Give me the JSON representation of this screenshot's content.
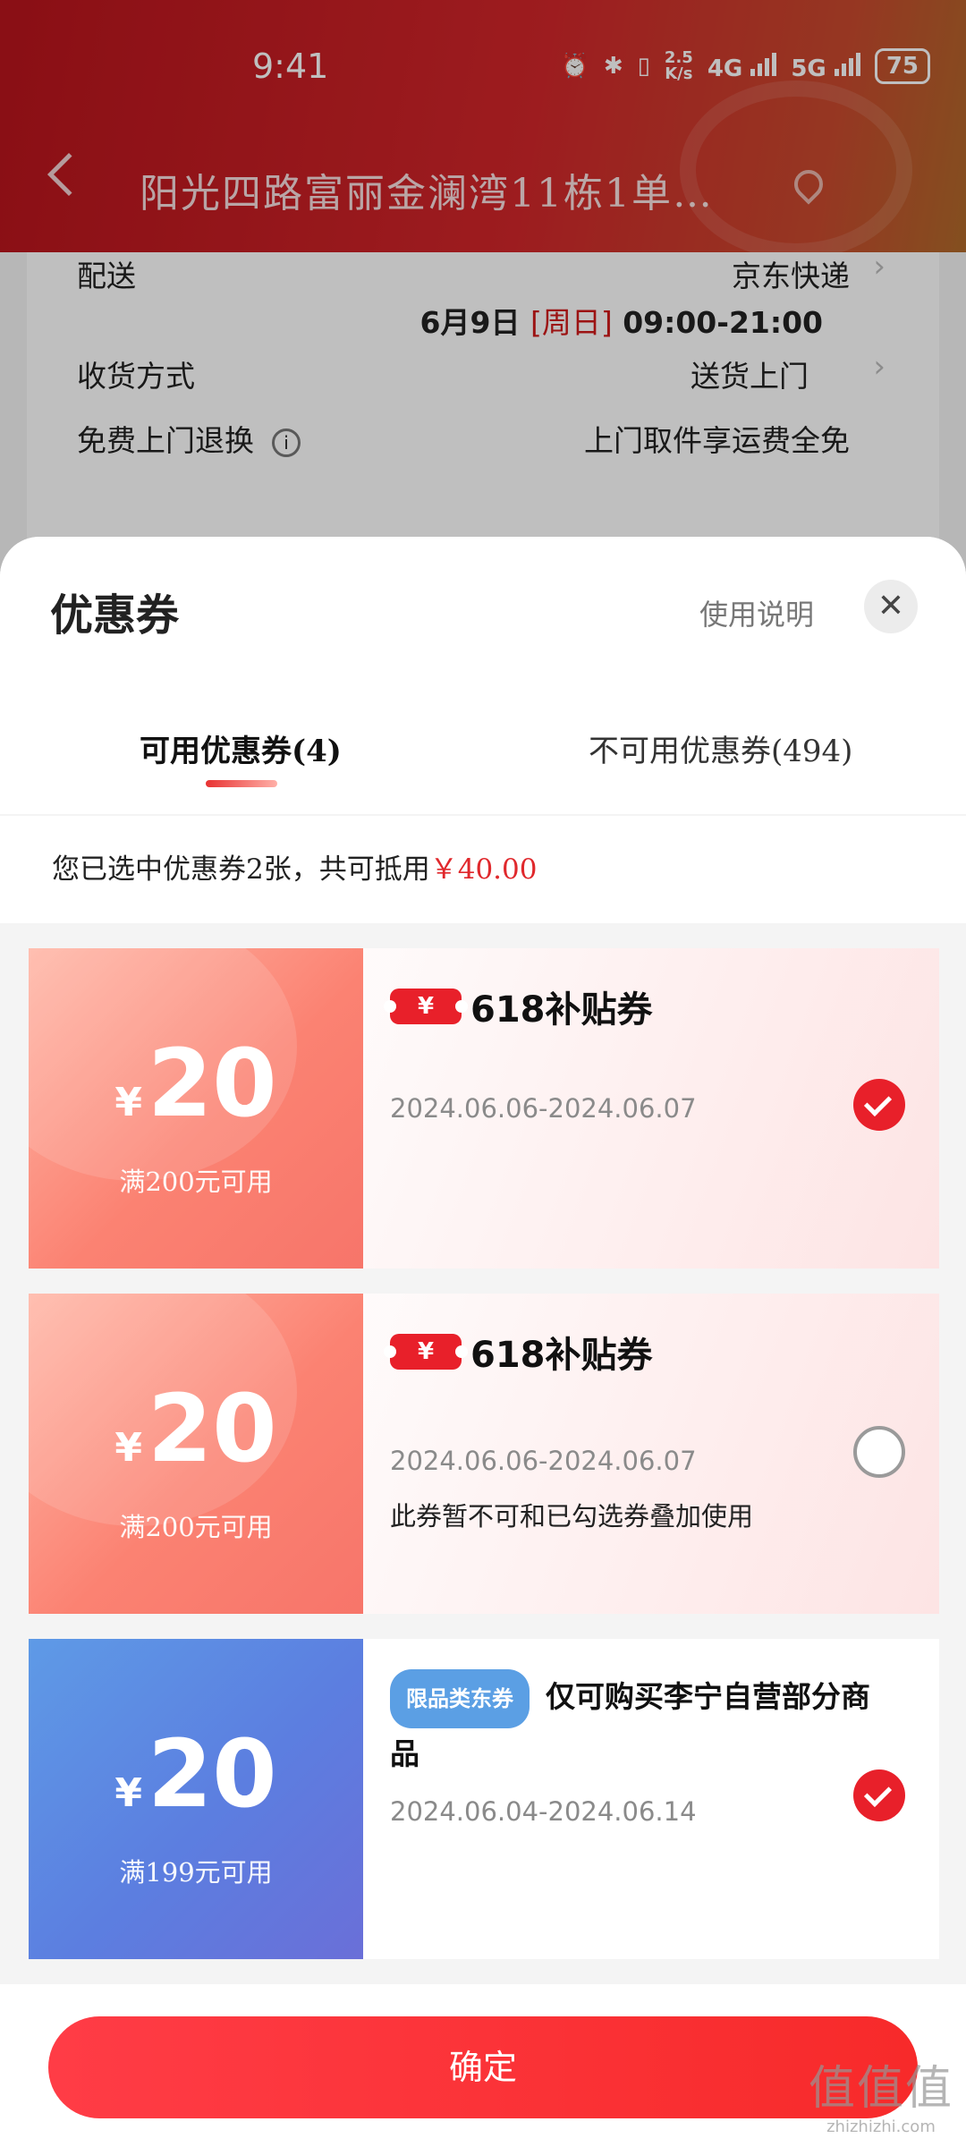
{
  "status_bar": {
    "time": "9:41",
    "net_speed_value": "2.5",
    "net_speed_unit": "K/s",
    "net_4g": "4G",
    "net_5g": "5G",
    "battery": "75"
  },
  "header": {
    "address": "阳光四路富丽金澜湾11栋1单…"
  },
  "order": {
    "delivery_label": "配送",
    "delivery_value": "京东快递",
    "delivery_date": "6月9日",
    "delivery_weekday": "[周日]",
    "delivery_time": "09:00-21:00",
    "receive_label": "收货方式",
    "receive_value": "送货上门",
    "return_label": "免费上门退换",
    "return_value": "上门取件享运费全免"
  },
  "sheet": {
    "title": "优惠券",
    "help": "使用说明",
    "close": "✕",
    "tabs": [
      {
        "label": "可用优惠券(4)"
      },
      {
        "label": "不可用优惠券(494)"
      }
    ],
    "summary_prefix": "您已选中优惠券2张，共可抵用",
    "summary_amount": "￥40.00"
  },
  "coupons": [
    {
      "currency": "¥",
      "amount": "20",
      "condition": "满200元可用",
      "badge": "¥",
      "name": "618补贴券",
      "validity": "2024.06.06-2024.06.07",
      "selected": true
    },
    {
      "currency": "¥",
      "amount": "20",
      "condition": "满200元可用",
      "badge": "¥",
      "name": "618补贴券",
      "validity": "2024.06.06-2024.06.07",
      "note": "此券暂不可和已勾选券叠加使用",
      "selected": false
    },
    {
      "currency": "¥",
      "amount": "20",
      "condition": "满199元可用",
      "tag": "限品类东券",
      "name": "仅可购买李宁自营部分商品",
      "validity": "2024.06.04-2024.06.14",
      "selected": true
    }
  ],
  "footer": {
    "confirm": "确定",
    "watermark": "值值值",
    "watermark_url": "zhizhizhi.com"
  },
  "colors": {
    "accent_red": "#e8202a",
    "coupon_red": "#f7756a",
    "coupon_blue": "#5c7ee0"
  }
}
